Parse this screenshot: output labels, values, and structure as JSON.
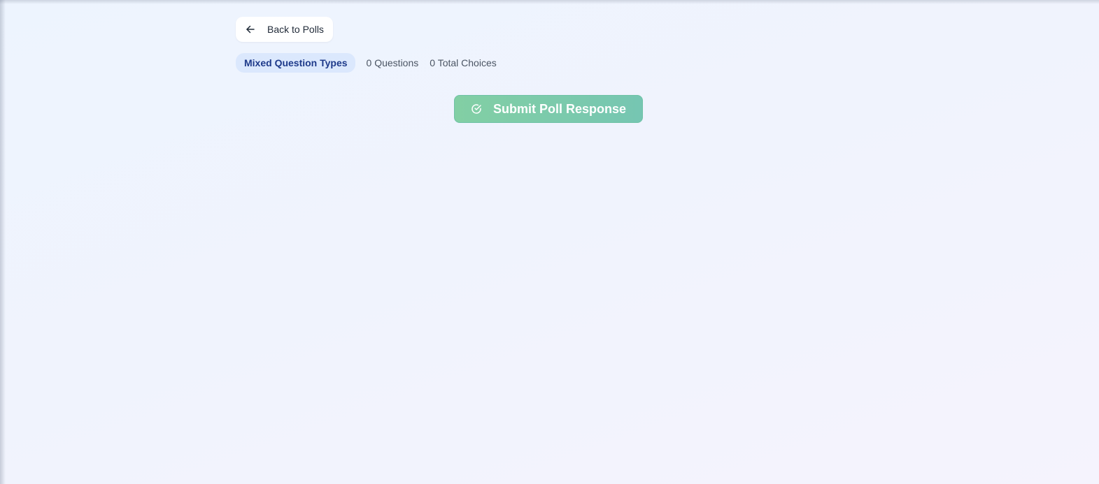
{
  "header": {
    "back_label": "Back to Polls",
    "back_icon": "arrow-left-icon"
  },
  "poll_meta": {
    "type_badge": "Mixed Question Types",
    "questions": "0 Questions",
    "total_choices": "0 Total Choices"
  },
  "actions": {
    "submit_label": "Submit Poll Response",
    "submit_icon": "check-circle-icon"
  },
  "colors": {
    "badge_bg": "#dbe8fd",
    "badge_text": "#1e3a8a",
    "submit_gradient_start": "#82cfa4",
    "submit_gradient_end": "#76c6b2"
  }
}
